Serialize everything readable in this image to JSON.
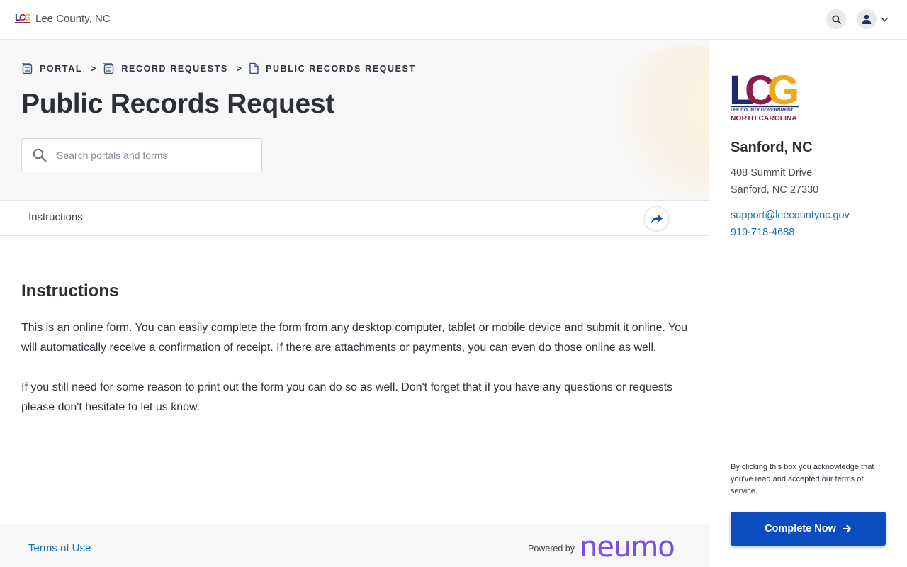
{
  "header": {
    "org_name": "Lee County, NC",
    "search_icon": "search-icon",
    "user_icon": "user-icon",
    "menu_icon": "chevron-down-icon"
  },
  "breadcrumb": [
    {
      "label": "PORTAL",
      "icon": "portal-icon"
    },
    {
      "label": "RECORD REQUESTS",
      "icon": "portal-icon"
    },
    {
      "label": "PUBLIC RECORDS REQUEST",
      "icon": "document-icon"
    }
  ],
  "breadcrumb_separator": ">",
  "page": {
    "title": "Public Records Request",
    "search_placeholder": "Search portals and forms"
  },
  "tabs": {
    "active": "Instructions",
    "share_icon": "share-icon"
  },
  "content": {
    "heading": "Instructions",
    "paragraphs": [
      "This is an online form. You can easily complete the form from any desktop computer, tablet or mobile device and submit it online. You will automatically receive a confirmation of receipt. If there are attachments or payments, you can even do those online as well.",
      "If you still need for some reason to print out the form you can do so as well. Don't forget that if you have any questions or requests please don't hesitate to let us know."
    ]
  },
  "footer": {
    "terms": "Terms of Use",
    "powered_by": "Powered by",
    "brand": "neumo"
  },
  "sidebar": {
    "logo": {
      "letters": "LCG",
      "line1": "LEE COUNTY GOVERNMENT",
      "line2": "NORTH CAROLINA"
    },
    "city": "Sanford, NC",
    "address_line1": "408 Summit Drive",
    "address_line2": "Sanford, NC 27330",
    "email": "support@leecountync.gov",
    "phone": "919-718-4688",
    "acknowledgement": "By clicking this box you acknowledge that you've read and accepted our terms of service.",
    "cta": "Complete Now"
  },
  "colors": {
    "primary_button": "#0b4dc1",
    "link": "#1a6fb0",
    "brand_purple": "#7b4fe0",
    "logo_navy": "#1f2a6b",
    "logo_maroon": "#8b1c4d",
    "logo_orange": "#f0a81c"
  }
}
